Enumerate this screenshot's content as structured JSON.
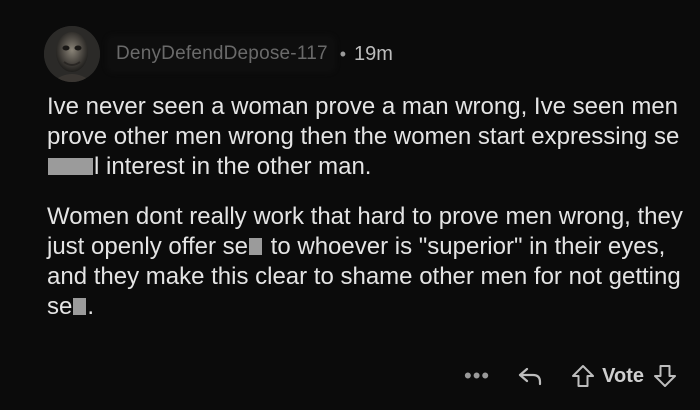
{
  "comment": {
    "username": "DenyDefendDepose-117",
    "separator": "•",
    "timestamp": "19m",
    "paragraph1": {
      "part_a": "Ive never seen a woman prove a man wrong, Ive seen men prove other men wrong then the women start expressing se",
      "part_b": "l interest in the other man."
    },
    "paragraph2": {
      "part_a": "Women dont really work that hard to prove men wrong, they just openly offer se",
      "part_b": " to whoever is \"superior\" in their eyes, and they make this clear to shame other men for not getting se",
      "part_c": "."
    }
  },
  "actions": {
    "more_label": "•••",
    "vote_label": "Vote"
  },
  "icons": {
    "avatar": "user-avatar",
    "reply": "reply-icon",
    "upvote": "upvote-arrow-icon",
    "downvote": "downvote-arrow-icon"
  },
  "colors": {
    "background": "#0b0b0b",
    "text": "#e4e4e4",
    "redaction": "#9b9b9b"
  }
}
